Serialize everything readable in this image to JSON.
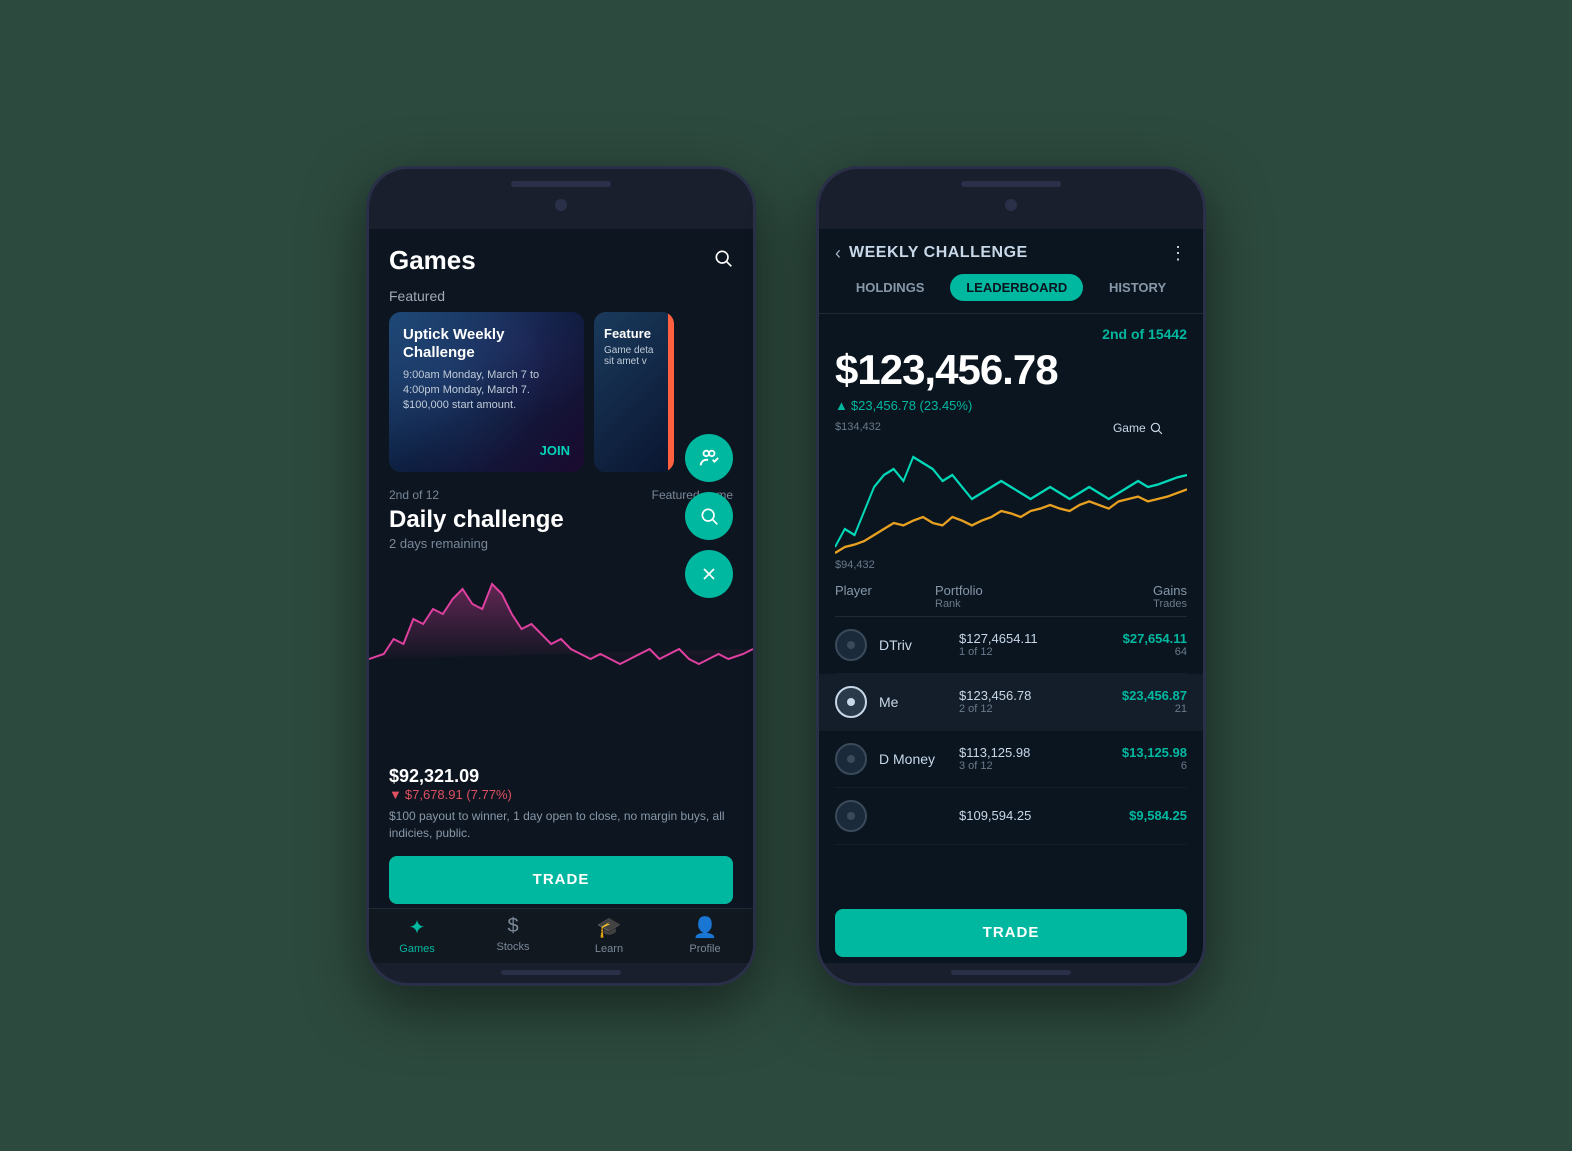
{
  "phone1": {
    "header": {
      "title": "Games",
      "search_label": "search"
    },
    "featured_label": "Featured",
    "featured_card1": {
      "title": "Uptick Weekly Challenge",
      "desc": "9:00am Monday, March 7 to 4:00pm Monday, March 7. $100,000 start amount.",
      "join": "JOIN"
    },
    "featured_card2": {
      "title": "Feature",
      "desc": "Game deta sit amet v"
    },
    "game": {
      "rank": "2nd of 12",
      "featured": "Featured game",
      "title": "Daily challenge",
      "subtitle": "2 days remaining",
      "value": "$92,321.09",
      "change": "▼ $7,678.91 (7.77%)",
      "desc": "$100 payout to winner, 1 day open to close, no margin buys, all indicies, public."
    },
    "trade_button": "TRADE",
    "nav": {
      "games": "Games",
      "stocks": "Stocks",
      "learn": "Learn",
      "profile": "Profile"
    }
  },
  "phone2": {
    "header": {
      "back": "‹",
      "title": "WEEKLY CHALLENGE",
      "menu": "⋮"
    },
    "tabs": [
      "HOLDINGS",
      "LEADERBOARD",
      "HISTORY"
    ],
    "active_tab": "LEADERBOARD",
    "rank": "2nd of 15442",
    "value": "$123,456.78",
    "change": "▲ $23,456.78 (23.45%)",
    "chart": {
      "top_label": "$134,432",
      "bottom_label": "$94,432",
      "game_label": "Game"
    },
    "leaderboard": {
      "col_player": "Player",
      "col_portfolio": "Portfolio",
      "col_portfolio_sub": "Rank",
      "col_gains": "Gains",
      "col_gains_sub": "Trades",
      "rows": [
        {
          "name": "DTriv",
          "portfolio": "$127,4654.11",
          "rank": "1 of 12",
          "gains": "$27,654.11",
          "trades": "64",
          "is_me": false
        },
        {
          "name": "Me",
          "portfolio": "$123,456.78",
          "rank": "2 of 12",
          "gains": "$23,456.87",
          "trades": "21",
          "is_me": true
        },
        {
          "name": "D Money",
          "portfolio": "$113,125.98",
          "rank": "3 of 12",
          "gains": "$13,125.98",
          "trades": "6",
          "is_me": false
        },
        {
          "name": "",
          "portfolio": "$109,594.25",
          "rank": "",
          "gains": "$9,584.25",
          "trades": "",
          "is_me": false
        }
      ]
    },
    "trade_button": "TRADE"
  }
}
